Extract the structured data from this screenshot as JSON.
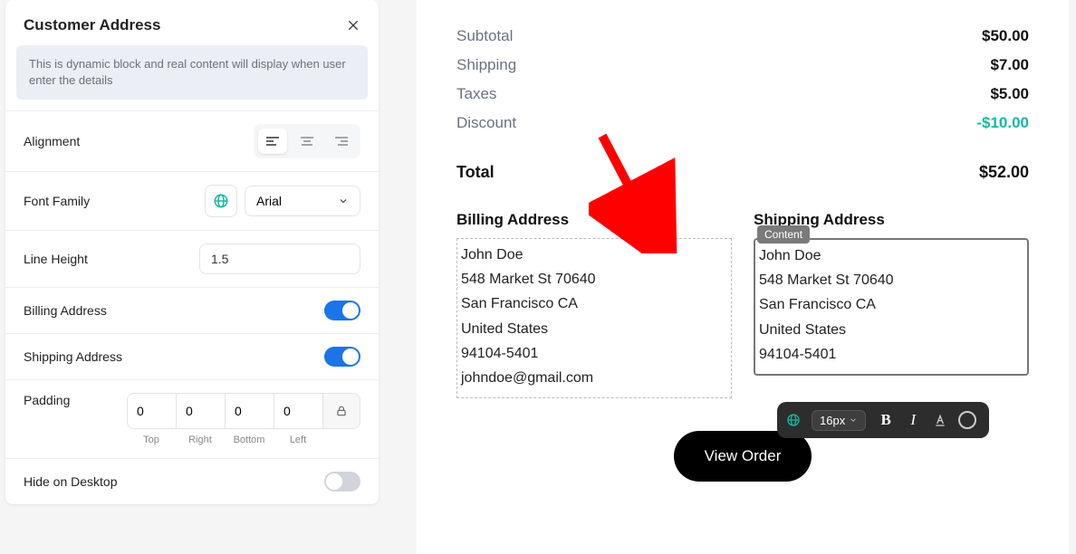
{
  "sidebar": {
    "title": "Customer Address",
    "notice": "This is dynamic block and real content will display when user enter the details",
    "alignment_label": "Alignment",
    "font_family_label": "Font Family",
    "font_family_value": "Arial",
    "line_height_label": "Line Height",
    "line_height_value": "1.5",
    "billing_label": "Billing Address",
    "shipping_label": "Shipping Address",
    "padding_label": "Padding",
    "padding_values": {
      "top": "0",
      "right": "0",
      "bottom": "0",
      "left": "0"
    },
    "padding_sides": {
      "top": "Top",
      "right": "Right",
      "bottom": "Bottom",
      "left": "Left"
    },
    "hide_desktop_label": "Hide on Desktop"
  },
  "summary": {
    "subtotal_label": "Subtotal",
    "subtotal_value": "$50.00",
    "shipping_label": "Shipping",
    "shipping_value": "$7.00",
    "taxes_label": "Taxes",
    "taxes_value": "$5.00",
    "discount_label": "Discount",
    "discount_value": "-$10.00",
    "total_label": "Total",
    "total_value": "$52.00"
  },
  "billing": {
    "title": "Billing Address",
    "line1": "John Doe",
    "line2": "548 Market St 70640",
    "line3": "San Francisco CA",
    "line4": "United States",
    "line5": "94104-5401",
    "line6": "johndoe@gmail.com"
  },
  "shipping": {
    "title": "Shipping Address",
    "badge": "Content",
    "line1": "John Doe",
    "line2": "548 Market St 70640",
    "line3": "San Francisco CA",
    "line4": "United States",
    "line5": "94104-5401"
  },
  "toolbar": {
    "font_size": "16px"
  },
  "cta": {
    "view_order": "View Order"
  }
}
